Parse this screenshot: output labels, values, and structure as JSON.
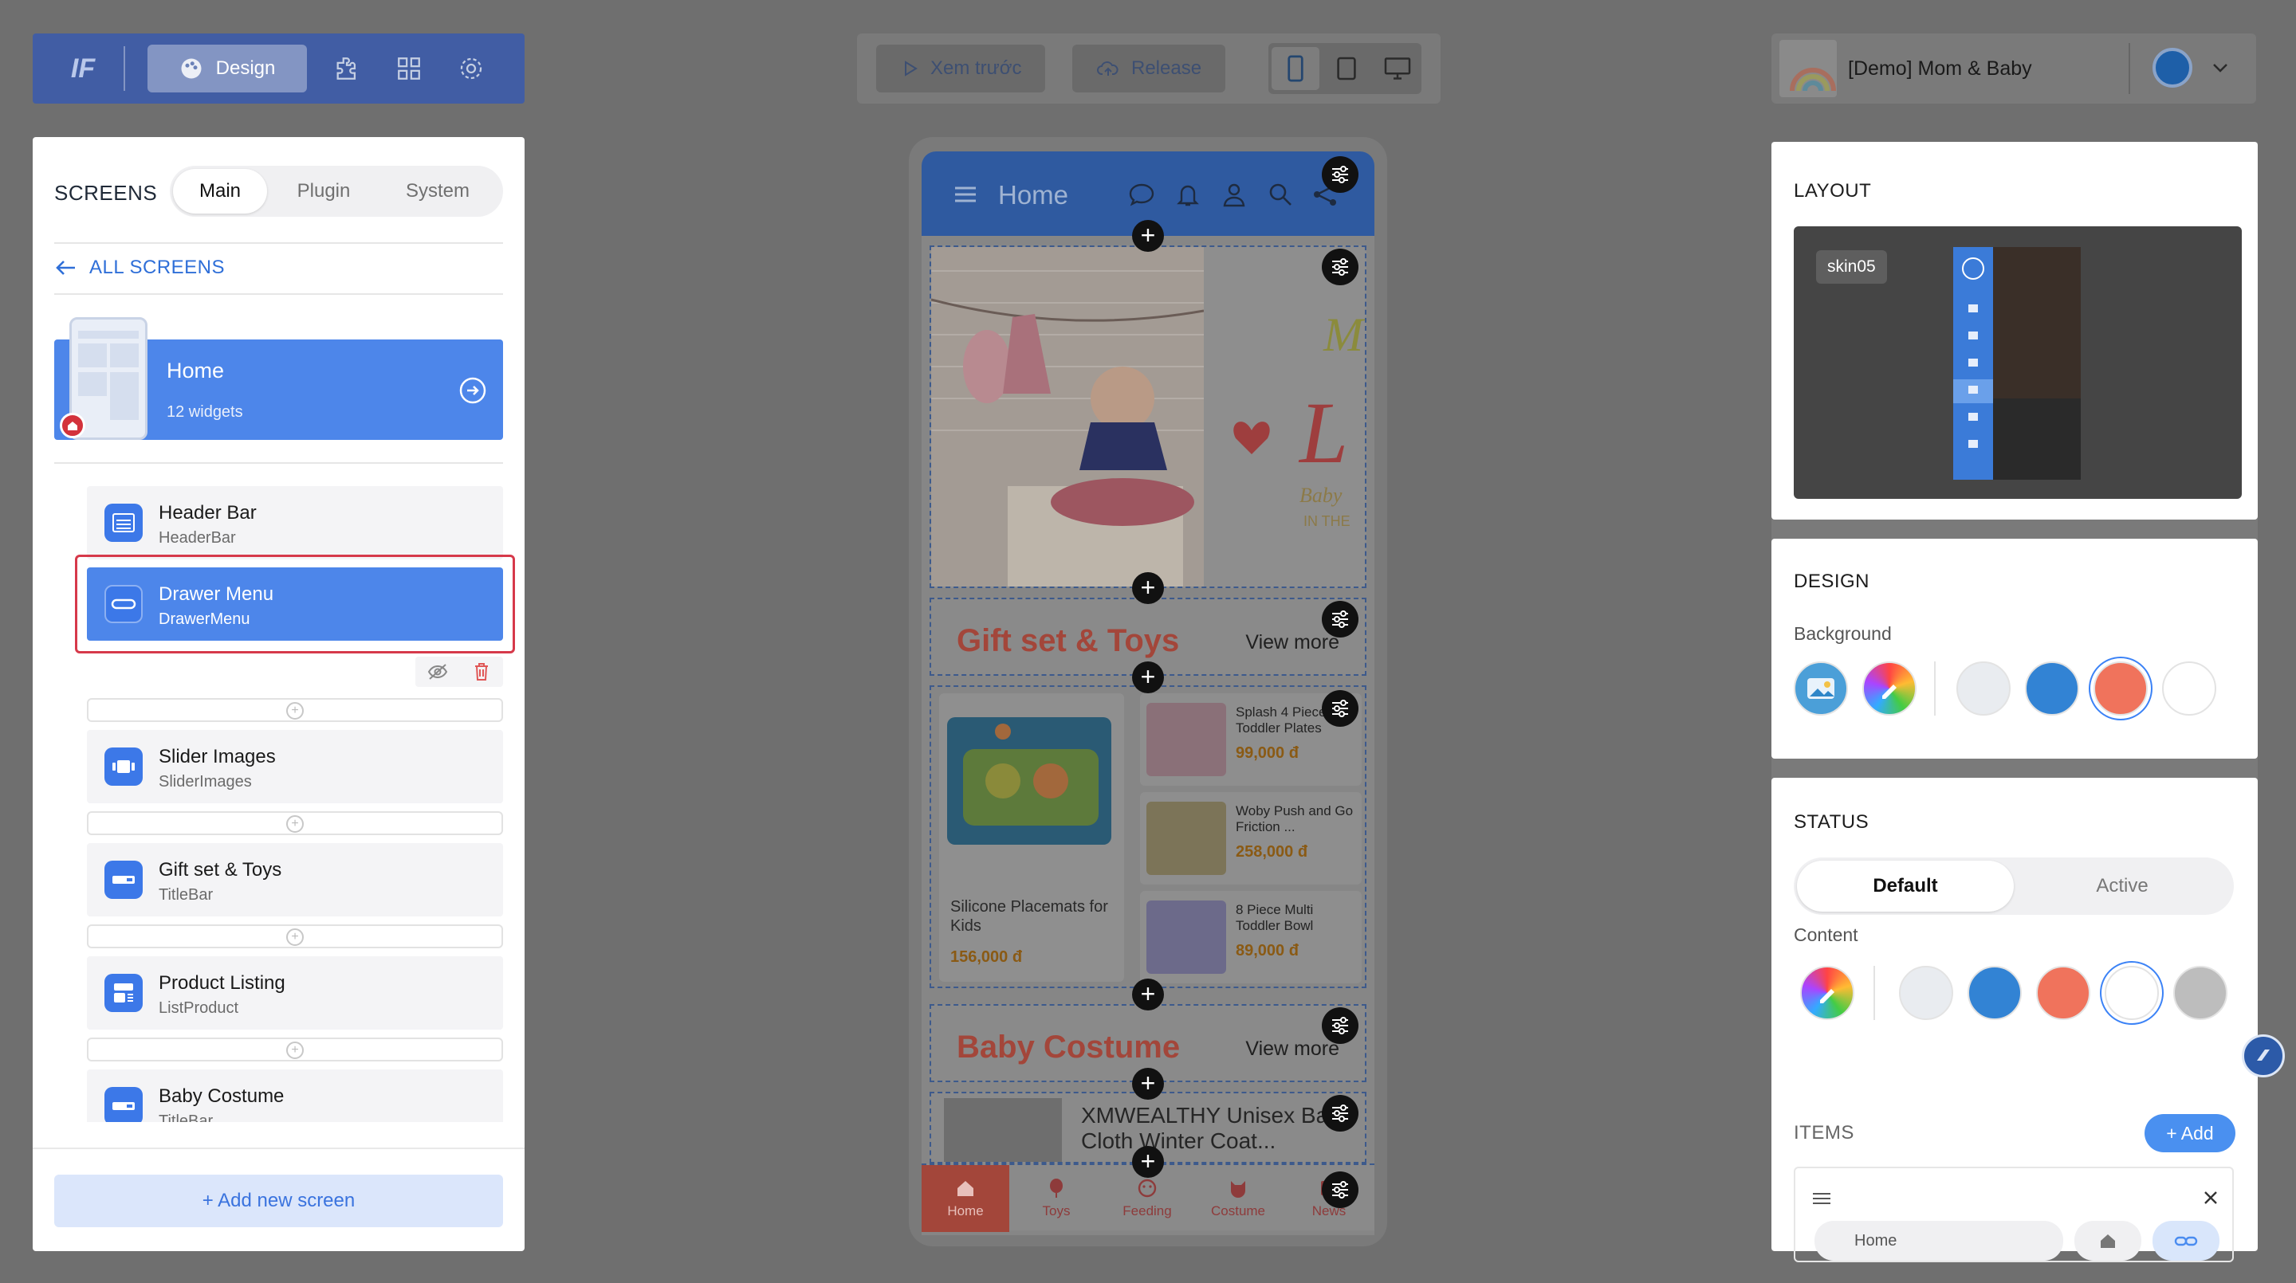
{
  "topbar": {
    "logo_text": "IF",
    "design_label": "Design",
    "icons": [
      "puzzle-icon",
      "grid-icon",
      "gear-icon"
    ]
  },
  "toolbar": {
    "preview_label": "Xem trước",
    "release_label": "Release",
    "devices": [
      "mobile",
      "tablet",
      "desktop"
    ]
  },
  "app": {
    "name": "[Demo] Mom & Baby"
  },
  "left": {
    "title": "SCREENS",
    "tabs": [
      "Main",
      "Plugin",
      "System"
    ],
    "active_tab": "Main",
    "back_label": "ALL SCREENS",
    "screen": {
      "title": "Home",
      "subtitle": "12 widgets"
    },
    "widgets": [
      {
        "name": "Header Bar",
        "type": "HeaderBar"
      },
      {
        "name": "Drawer Menu",
        "type": "DrawerMenu"
      },
      {
        "name": "Slider Images",
        "type": "SliderImages"
      },
      {
        "name": "Gift set & Toys",
        "type": "TitleBar"
      },
      {
        "name": "Product Listing",
        "type": "ListProduct"
      },
      {
        "name": "Baby Costume",
        "type": "TitleBar"
      }
    ],
    "add_screen_label": "+ Add new screen"
  },
  "phone": {
    "header_title": "Home",
    "section1": {
      "title": "Gift set & Toys",
      "more": "View more"
    },
    "big_product": {
      "name": "Silicone Placemats for Kids",
      "price": "156,000 đ"
    },
    "small_products": [
      {
        "name": "Splash 4 Piece Toddler Plates",
        "price": "99,000 đ"
      },
      {
        "name": "Woby Push and Go Friction ...",
        "price": "258,000 đ"
      },
      {
        "name": "8 Piece Multi Toddler Bowl",
        "price": "89,000 đ"
      }
    ],
    "section2": {
      "title": "Baby Costume",
      "more": "View more"
    },
    "list_item": "XMWEALTHY Unisex Baby Cloth Winter Coat...",
    "bottom_nav": [
      "Home",
      "Toys",
      "Feeding",
      "Costume",
      "News"
    ]
  },
  "right": {
    "layout_title": "LAYOUT",
    "skin_label": "skin05",
    "design_title": "DESIGN",
    "background_label": "Background",
    "bg_swatches": [
      "#e9ecf0",
      "#3283d4",
      "#f0735c",
      "#ffffff"
    ],
    "status_title": "STATUS",
    "status_tabs": [
      "Default",
      "Active"
    ],
    "content_label": "Content",
    "content_swatches": [
      "#e9ecf0",
      "#3283d4",
      "#f0735c",
      "#ffffff",
      "#bdbdbd"
    ],
    "items_title": "ITEMS",
    "add_label": "+ Add",
    "item_label": "Home"
  },
  "colors": {
    "accent": "#4d86ea",
    "danger": "#d6394a",
    "brand_red": "#a3463a"
  }
}
